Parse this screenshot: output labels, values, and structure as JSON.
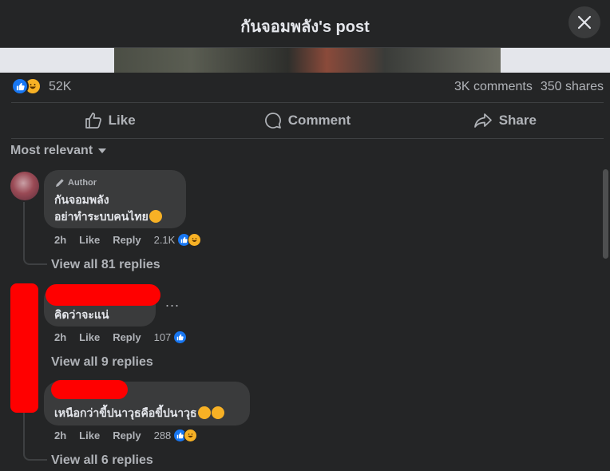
{
  "header": {
    "title": "กันจอมพลัง's post",
    "close_icon": "close-icon"
  },
  "post": {
    "reaction_count": "52K",
    "comments_count": "3K comments",
    "shares_count": "350 shares",
    "reactions": [
      "like-icon",
      "haha-icon"
    ]
  },
  "actions": {
    "like_label": "Like",
    "comment_label": "Comment",
    "share_label": "Share"
  },
  "sort": {
    "label": "Most relevant"
  },
  "comments": [
    {
      "badge": "Author",
      "author": "กันจอมพลัง",
      "text": "อย่าทำระบบคนไทย",
      "time": "2h",
      "like": "Like",
      "reply": "Reply",
      "reaction_count": "2.1K",
      "view_replies": "View all 81 replies"
    },
    {
      "author": "",
      "text": "คิดว่าจะแน่",
      "time": "2h",
      "like": "Like",
      "reply": "Reply",
      "reaction_count": "107",
      "view_replies": "View all 9 replies",
      "more": "..."
    },
    {
      "author": "",
      "text": "เหนือกว่าขี้ปนาวุธคือขี้ปนาวุธ",
      "time": "2h",
      "like": "Like",
      "reply": "Reply",
      "reaction_count": "288",
      "view_replies": "View all 6 replies"
    }
  ],
  "colors": {
    "background": "#242526",
    "bubble": "#3a3b3c",
    "text_primary": "#e4e6eb",
    "text_secondary": "#b0b3b8",
    "like_blue": "#1877f2",
    "haha_yellow": "#f7b125",
    "redaction": "#ff0000"
  }
}
